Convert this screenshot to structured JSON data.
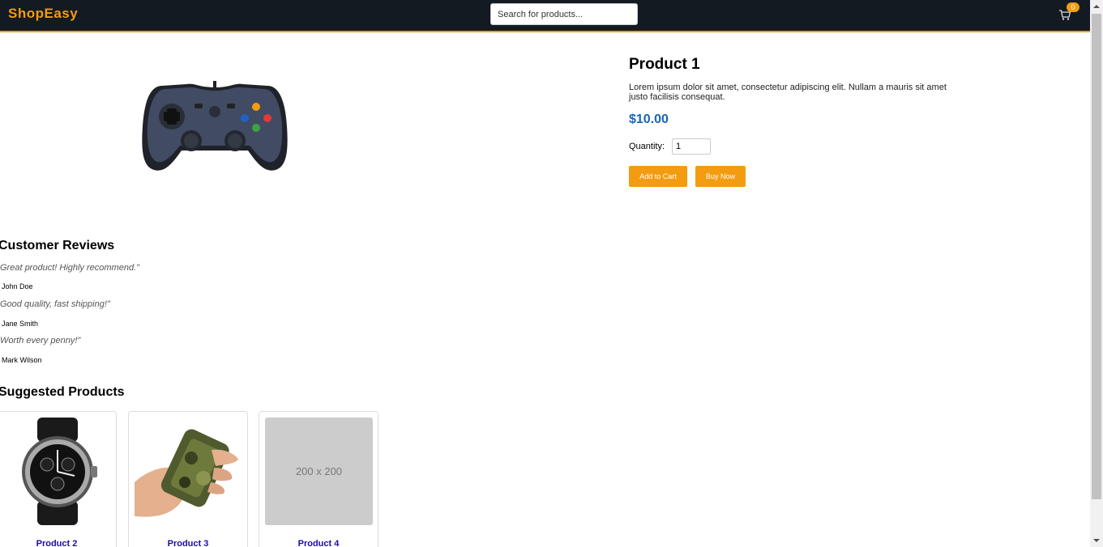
{
  "header": {
    "logo": "ShopEasy",
    "search_placeholder": "Search for products...",
    "cart_count": "0"
  },
  "product": {
    "title": "Product 1",
    "description": "Lorem ipsum dolor sit amet, consectetur adipiscing elit. Nullam a mauris sit amet justo facilisis consequat.",
    "price": "$10.00",
    "quantity_label": "Quantity:",
    "quantity_value": "1",
    "add_to_cart_label": "Add to Cart",
    "buy_now_label": "Buy Now",
    "image_icon": "gamepad-icon"
  },
  "reviews": {
    "title": "Customer Reviews",
    "items": [
      {
        "text": "Great product! Highly recommend.\"",
        "author": "John Doe"
      },
      {
        "text": "Good quality, fast shipping!\"",
        "author": "Jane Smith"
      },
      {
        "text": "Worth every penny!\"",
        "author": "Mark Wilson"
      }
    ]
  },
  "suggested": {
    "title": "Suggested Products",
    "items": [
      {
        "name": "Product 2",
        "image_icon": "watch-icon"
      },
      {
        "name": "Product 3",
        "image_icon": "power-bank-icon"
      },
      {
        "name": "Product 4",
        "placeholder_text": "200 x 200"
      }
    ]
  },
  "colors": {
    "header_bg": "#131a22",
    "accent": "#f39c12",
    "price": "#1565c0",
    "link": "#1a0dab"
  }
}
